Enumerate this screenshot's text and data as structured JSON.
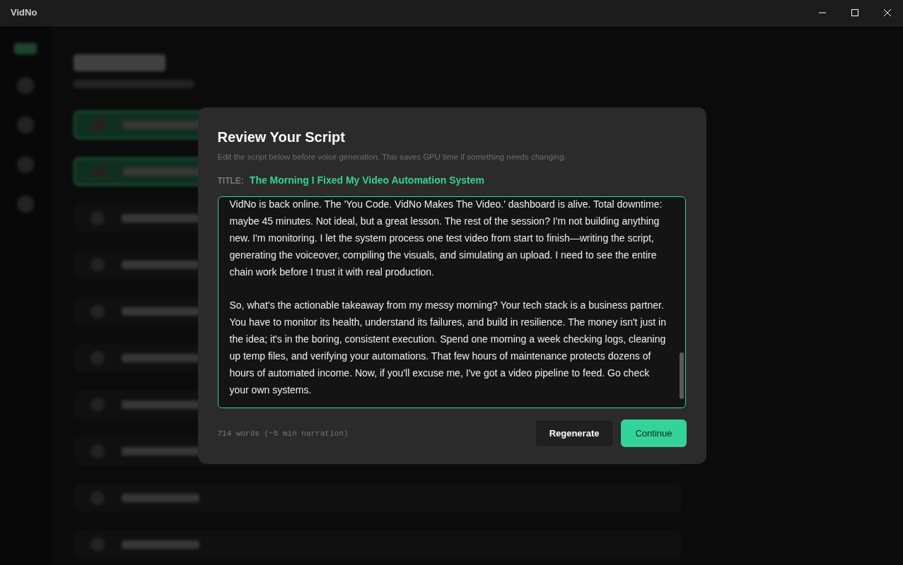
{
  "window": {
    "title": "VidNo"
  },
  "modal": {
    "title": "Review Your Script",
    "subtitle": "Edit the script below before voice generation. This saves GPU time if something needs changing.",
    "title_label": "TITLE:",
    "video_title": "The Morning I Fixed My Video Automation System",
    "script_paragraphs": [
      "VidNo is back online. The 'You Code. VidNo Makes The Video.' dashboard is alive. Total downtime: maybe 45 minutes. Not ideal, but a great lesson. The rest of the session? I'm not building anything new. I'm monitoring. I let the system process one test video from start to finish—writing the script, generating the voiceover, compiling the visuals, and simulating an upload. I need to see the entire chain work before I trust it with real production.",
      "So, what's the actionable takeaway from my messy morning? Your tech stack is a business partner. You have to monitor its health, understand its failures, and build in resilience. The money isn't just in the idea; it's in the boring, consistent execution. Spend one morning a week checking logs, cleaning up temp files, and verifying your automations. That few hours of maintenance protects dozens of hours of automated income. Now, if you'll excuse me, I've got a video pipeline to feed. Go check your own systems."
    ],
    "word_count": "714 words (~5 min narration)",
    "buttons": [
      {
        "label": "Regenerate",
        "kind": "secondary"
      },
      {
        "label": "Continue",
        "kind": "primary"
      }
    ]
  },
  "background_steps": [
    {
      "selected": true
    },
    {
      "selected": true
    },
    {
      "selected": false
    },
    {
      "selected": false
    },
    {
      "selected": false
    },
    {
      "selected": false
    },
    {
      "selected": false
    },
    {
      "selected": false
    },
    {
      "selected": false
    },
    {
      "selected": false
    }
  ]
}
